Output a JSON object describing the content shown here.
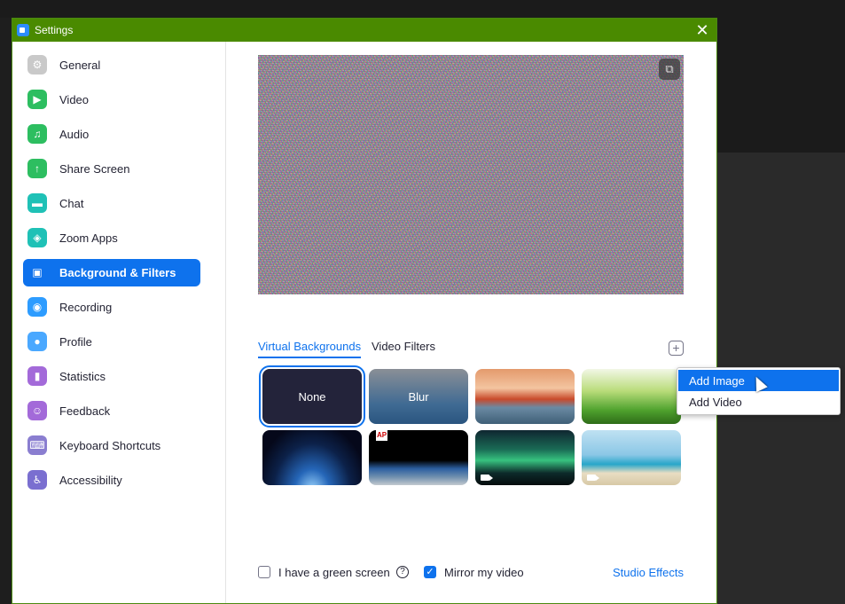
{
  "window": {
    "title": "Settings",
    "close_symbol": "✕"
  },
  "sidebar": {
    "items": [
      {
        "label": "General",
        "icon": "gear-icon",
        "color": "#c9c9c9",
        "glyph": "⚙"
      },
      {
        "label": "Video",
        "icon": "video-camera-icon",
        "color": "#2dbe60",
        "glyph": "▶"
      },
      {
        "label": "Audio",
        "icon": "headphones-icon",
        "color": "#2dbe60",
        "glyph": "♫"
      },
      {
        "label": "Share Screen",
        "icon": "share-screen-icon",
        "color": "#2dbe60",
        "glyph": "↑"
      },
      {
        "label": "Chat",
        "icon": "chat-bubble-icon",
        "color": "#1fc1b6",
        "glyph": "▬"
      },
      {
        "label": "Zoom Apps",
        "icon": "zoom-apps-icon",
        "color": "#1fc1b6",
        "glyph": "◈"
      },
      {
        "label": "Background & Filters",
        "icon": "background-person-icon",
        "color": "#0e72ed",
        "glyph": "▣",
        "active": true
      },
      {
        "label": "Recording",
        "icon": "record-circle-icon",
        "color": "#2d9cff",
        "glyph": "◉"
      },
      {
        "label": "Profile",
        "icon": "profile-person-icon",
        "color": "#4aa8ff",
        "glyph": "●"
      },
      {
        "label": "Statistics",
        "icon": "bar-chart-icon",
        "color": "#a36ad9",
        "glyph": "▮"
      },
      {
        "label": "Feedback",
        "icon": "smiley-icon",
        "color": "#a36ad9",
        "glyph": "☺"
      },
      {
        "label": "Keyboard Shortcuts",
        "icon": "keyboard-icon",
        "color": "#8a7ed0",
        "glyph": "⌨"
      },
      {
        "label": "Accessibility",
        "icon": "accessibility-icon",
        "color": "#7a6fd0",
        "glyph": "♿"
      }
    ]
  },
  "main": {
    "preview_toggle_symbol": "⧉",
    "tabs": [
      {
        "label": "Virtual Backgrounds",
        "active": true
      },
      {
        "label": "Video Filters",
        "active": false
      }
    ],
    "add_symbol": "+",
    "backgrounds": [
      {
        "label": "None",
        "selected": true,
        "bg": "#23233a"
      },
      {
        "label": "Blur",
        "bg": "linear-gradient(#8a8f96,#3f6a93 65%,#2a557f)"
      },
      {
        "label": "",
        "name": "golden-gate-bridge",
        "bg": "linear-gradient(#e49a6c,#f3c4a0 35%,#c94a2b 55%,#6b8aa3 70%,#3f5f77)"
      },
      {
        "label": "",
        "name": "grass",
        "bg": "linear-gradient(#f2f7e6,#b9dc7a 40%,#4fa22e 75%,#2e6c18)"
      },
      {
        "label": "",
        "name": "earth-from-space",
        "bg": "radial-gradient(ellipse at 50% 110%,#9fd7ff 0%,#2566b8 25%,#0c2149 55%,#05081a 80%)"
      },
      {
        "label": "",
        "name": "ap-earth",
        "bg": "linear-gradient(#000 0%,#000 55%,#2b5ea0 70%,#6f8fae 85%,#c2c9cf)",
        "ap": "AP"
      },
      {
        "label": "",
        "name": "northern-lights",
        "video": true,
        "bg": "linear-gradient(#0f2630,#1a6b55 35%,#37c27f 55%,#0d2a2a 78%,#050c0d)"
      },
      {
        "label": "",
        "name": "beach-palm",
        "video": true,
        "bg": "linear-gradient(#bfe1f2,#8bc7e6 45%,#28a6c9 62%,#e9ddc3 78%,#d7c9a6)"
      }
    ],
    "green_screen_label": "I have a green screen",
    "green_screen_checked": false,
    "help_symbol": "?",
    "mirror_label": "Mirror my video",
    "mirror_checked": true,
    "checkmark_symbol": "✓",
    "studio_effects_label": "Studio Effects"
  },
  "add_menu": {
    "items": [
      {
        "label": "Add Image",
        "highlighted": true
      },
      {
        "label": "Add Video",
        "highlighted": false
      }
    ]
  }
}
